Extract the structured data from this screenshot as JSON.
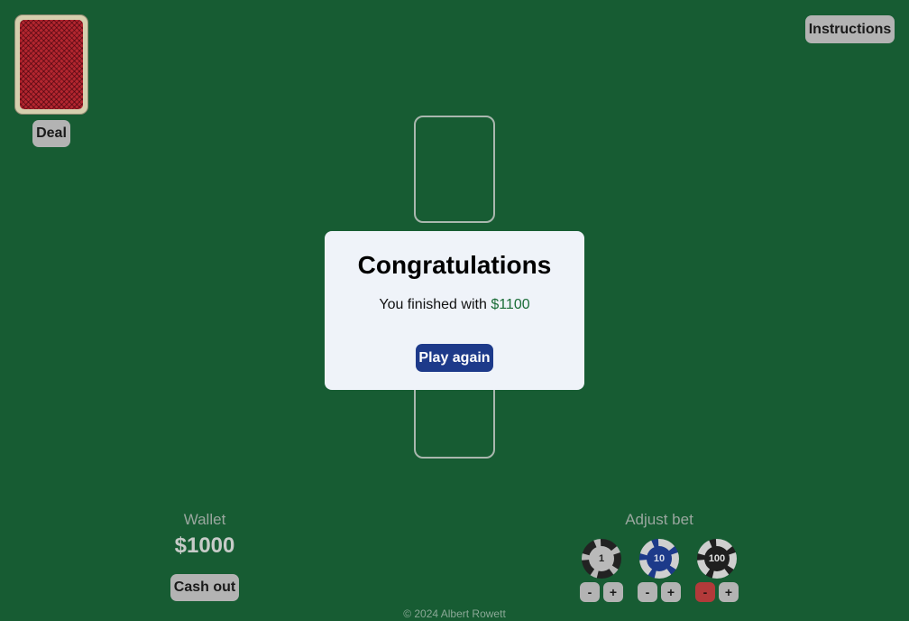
{
  "header": {
    "instructions_label": "Instructions",
    "deal_label": "Deal"
  },
  "deck": {
    "icon": "card-back-icon",
    "back_color": "#b3262f"
  },
  "modal": {
    "title": "Congratulations",
    "message_prefix": "You finished with",
    "final_amount": "$1100",
    "play_again_label": "Play again"
  },
  "wallet": {
    "label": "Wallet",
    "value": "$1000",
    "cash_out_label": "Cash out"
  },
  "bet": {
    "label": "Adjust bet",
    "chips": [
      {
        "value": "1",
        "minus": "-",
        "plus": "+"
      },
      {
        "value": "10",
        "minus": "-",
        "plus": "+"
      },
      {
        "value": "100",
        "minus": "-",
        "plus": "+"
      }
    ]
  },
  "footer": {
    "copyright": "© 2024 Albert Rowett"
  },
  "colors": {
    "table": "#175c33",
    "modal_bg": "#eff3f9",
    "primary_button": "#1d3a8a",
    "amount_green": "#1a6d37",
    "danger": "#b23a3a"
  }
}
